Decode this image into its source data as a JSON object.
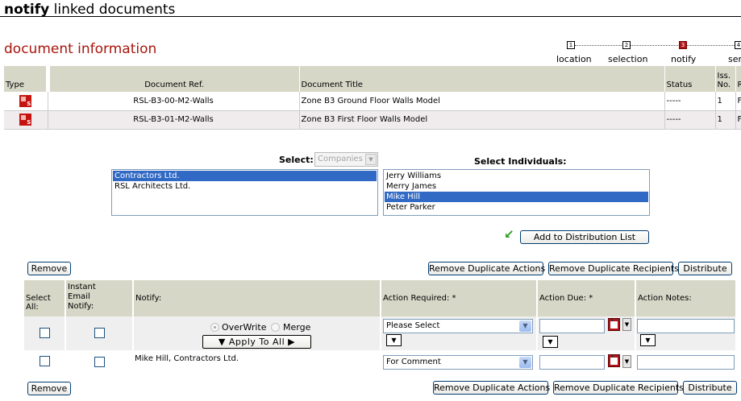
{
  "page": {
    "title_bold": "notify",
    "title_rest": "linked documents",
    "section_title": "document information"
  },
  "steps": [
    {
      "num": "1",
      "label": "location",
      "active": false
    },
    {
      "num": "2",
      "label": "selection",
      "active": false
    },
    {
      "num": "3",
      "label": "notify",
      "active": true
    },
    {
      "num": "4",
      "label": "ser",
      "active": false
    }
  ],
  "documents": {
    "headers": {
      "type": "Type",
      "ref": "Document Ref.",
      "title": "Document Title",
      "status": "Status",
      "iss_no": "Iss. No.",
      "rev": "R"
    },
    "rows": [
      {
        "ref": "RSL-B3-00-M2-Walls",
        "title": "Zone B3 Ground Floor Walls Model",
        "status": "-----",
        "iss_no": "1",
        "rev": "F"
      },
      {
        "ref": "RSL-B3-01-M2-Walls",
        "title": "Zone B3 First Floor Walls Model",
        "status": "-----",
        "iss_no": "1",
        "rev": "F"
      }
    ]
  },
  "select": {
    "label": "Select:",
    "value": "Companies",
    "companies": [
      {
        "name": "Contractors Ltd.",
        "selected": true
      },
      {
        "name": "RSL Architects Ltd.",
        "selected": false
      }
    ],
    "individuals_label": "Select Individuals:",
    "individuals": [
      {
        "name": "Jerry Williams",
        "selected": false
      },
      {
        "name": "Merry James",
        "selected": false
      },
      {
        "name": "Mike Hill",
        "selected": true
      },
      {
        "name": "Peter Parker",
        "selected": false
      }
    ],
    "add_button": "Add to Distribution List"
  },
  "actions": {
    "remove": "Remove",
    "remove_dup_actions": "Remove Duplicate Actions",
    "remove_dup_recipients": "Remove Duplicate Recipients",
    "distribute": "Distribute",
    "headers": {
      "select_all": "Select All:",
      "instant_email": "Instant Email Notify:",
      "notify": "Notify:",
      "action_required": "Action Required: *",
      "action_due": "Action Due: *",
      "action_notes": "Action Notes:"
    },
    "overwrite": "OverWrite",
    "merge": "Merge",
    "apply_all": "Apply To All",
    "row_template": {
      "action_required": "Please Select"
    },
    "rows": [
      {
        "notify": "Mike Hill, Contractors Ltd.",
        "action_required": "For Comment"
      }
    ]
  }
}
